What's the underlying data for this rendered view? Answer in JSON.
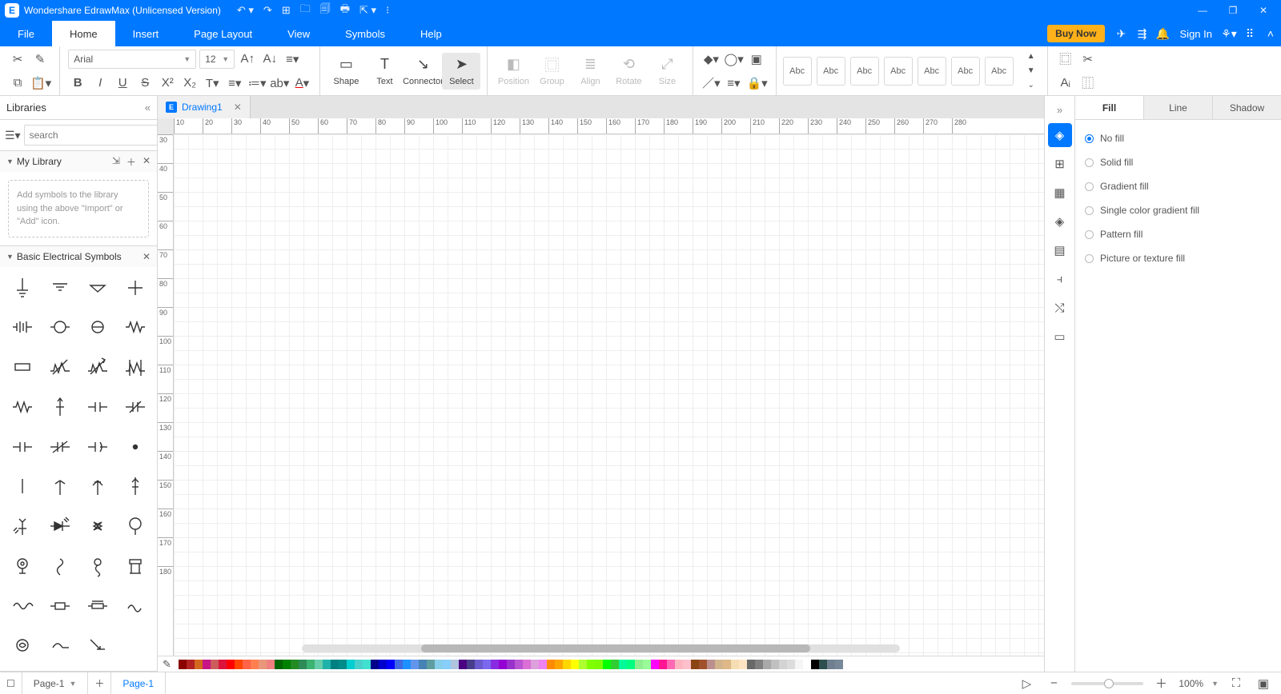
{
  "title": "Wondershare EdrawMax (Unlicensed Version)",
  "qat": [
    "↶ ▾",
    "↷",
    "⊞",
    "🗀",
    "🗐",
    "🖶",
    "⇱ ▾",
    "⁝"
  ],
  "win": [
    "—",
    "❐",
    "✕"
  ],
  "menu": {
    "tabs": [
      "File",
      "Home",
      "Insert",
      "Page Layout",
      "View",
      "Symbols",
      "Help"
    ],
    "active": "Home",
    "buy": "Buy Now",
    "signin": "Sign In"
  },
  "ribbon": {
    "font": {
      "family": "Arial",
      "size": "12"
    },
    "tools": [
      {
        "k": "shape",
        "label": "Shape",
        "icon": "▭"
      },
      {
        "k": "text",
        "label": "Text",
        "icon": "T"
      },
      {
        "k": "connector",
        "label": "Connector",
        "icon": "↘"
      },
      {
        "k": "select",
        "label": "Select",
        "icon": "➤",
        "active": true
      }
    ],
    "arrange": [
      {
        "k": "position",
        "label": "Position",
        "icon": "◧",
        "dis": true
      },
      {
        "k": "group",
        "label": "Group",
        "icon": "⿴",
        "dis": true
      },
      {
        "k": "align",
        "label": "Align",
        "icon": "≣",
        "dis": true
      },
      {
        "k": "rotate",
        "label": "Rotate",
        "icon": "⟲",
        "dis": true
      },
      {
        "k": "size",
        "label": "Size",
        "icon": "⤢",
        "dis": true
      }
    ],
    "style_label": "Abc"
  },
  "libraries": {
    "title": "Libraries",
    "search_placeholder": "search",
    "mylib": {
      "title": "My Library",
      "hint": "Add symbols to the library using the above \"Import\" or \"Add\" icon."
    },
    "sec2": {
      "title": "Basic Electrical Symbols"
    }
  },
  "doc": {
    "tab": "Drawing1"
  },
  "ruler_h": [
    10,
    20,
    30,
    40,
    50,
    60,
    70,
    80,
    90,
    100,
    110,
    120,
    130,
    140,
    150,
    160,
    170,
    180,
    190,
    200,
    210,
    220,
    230,
    240,
    250,
    260,
    270,
    280
  ],
  "ruler_v": [
    30,
    40,
    50,
    60,
    70,
    80,
    90,
    100,
    110,
    120,
    130,
    140,
    150,
    160,
    170,
    180
  ],
  "right_tabs": [
    "Fill",
    "Line",
    "Shadow"
  ],
  "right_active": "Fill",
  "fill_options": [
    "No fill",
    "Solid fill",
    "Gradient fill",
    "Single color gradient fill",
    "Pattern fill",
    "Picture or texture fill"
  ],
  "fill_selected": "No fill",
  "status": {
    "page_selector": "Page-1",
    "pagetab": "Page-1",
    "zoom": "100%"
  },
  "colorbar": [
    "#8b0000",
    "#b22222",
    "#d2691e",
    "#c71585",
    "#cd5c5c",
    "#dc143c",
    "#ff0000",
    "#ff4500",
    "#ff6347",
    "#ff7f50",
    "#e9967a",
    "#f08080",
    "#006400",
    "#008000",
    "#228b22",
    "#2e8b57",
    "#3cb371",
    "#66cdaa",
    "#20b2aa",
    "#008080",
    "#008b8b",
    "#00ced1",
    "#48d1cc",
    "#40e0d0",
    "#00008b",
    "#0000cd",
    "#0000ff",
    "#4169e1",
    "#1e90ff",
    "#6495ed",
    "#4682b4",
    "#5f9ea0",
    "#87ceeb",
    "#87cefa",
    "#b0c4de",
    "#4b0082",
    "#483d8b",
    "#6a5acd",
    "#7b68ee",
    "#8a2be2",
    "#9400d3",
    "#9932cc",
    "#ba55d3",
    "#da70d6",
    "#dda0dd",
    "#ee82ee",
    "#ff8c00",
    "#ffa500",
    "#ffd700",
    "#ffff00",
    "#adff2f",
    "#7fff00",
    "#7cfc00",
    "#00ff00",
    "#32cd32",
    "#00fa9a",
    "#00ff7f",
    "#90ee90",
    "#98fb98",
    "#ff00ff",
    "#ff1493",
    "#ff69b4",
    "#ffb6c1",
    "#ffc0cb",
    "#8b4513",
    "#a0522d",
    "#bc8f8f",
    "#d2b48c",
    "#deb887",
    "#f5deb3",
    "#ffe4c4",
    "#696969",
    "#808080",
    "#a9a9a9",
    "#c0c0c0",
    "#d3d3d3",
    "#dcdcdc",
    "#f5f5f5",
    "#ffffff",
    "#000000",
    "#2f4f4f",
    "#708090",
    "#778899"
  ]
}
